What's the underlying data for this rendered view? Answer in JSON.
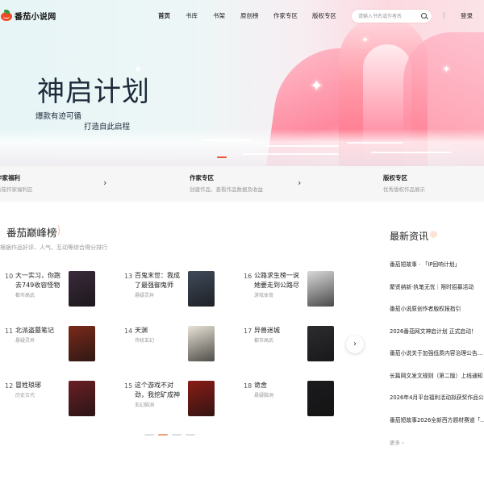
{
  "header": {
    "logo_text": "番茄小说网",
    "nav": [
      "首页",
      "书库",
      "书架",
      "原创榜",
      "作家专区",
      "版权专区"
    ],
    "search_placeholder": "请输入书名或作者名",
    "login": "登录"
  },
  "banner": {
    "title": "神启计划",
    "subtitle_line1": "爆款有迹可循",
    "subtitle_line2": "打造自此启程"
  },
  "features": [
    {
      "title": "作家福利",
      "desc": "番茄作家福利区"
    },
    {
      "title": "作家专区",
      "desc": "创建作品、查看作品数据及收益"
    },
    {
      "title": "版权专区",
      "desc": "优秀版权作品展示"
    }
  ],
  "ranking": {
    "title": "番茄巅峰榜",
    "desc": "根据作品好评、人气、互动等综合得分排行",
    "books": [
      {
        "num": "10",
        "title": "大一实习，你跑去749收容怪物",
        "genre": "都市高武",
        "cover": "#3a2a3a"
      },
      {
        "num": "11",
        "title": "北派盗墓笔记",
        "genre": "悬疑灵异",
        "cover": "#7a2a1a"
      },
      {
        "num": "12",
        "title": "冒姓琅琊",
        "genre": "历史古代",
        "cover": "#6a1f24"
      },
      {
        "num": "13",
        "title": "百鬼末世：我成了最强御鬼师",
        "genre": "悬疑灵异",
        "cover": "#3f4a5a"
      },
      {
        "num": "14",
        "title": "天渊",
        "genre": "传统玄幻",
        "cover": "#e9e3d6"
      },
      {
        "num": "15",
        "title": "这个游戏不对劲，我挖矿成神",
        "genre": "玄幻脑洞",
        "cover": "#8a1c16"
      },
      {
        "num": "16",
        "title": "公路求生榜一说她要走到公路尽头",
        "genre": "游戏体育",
        "cover": "#d9d9d9"
      },
      {
        "num": "17",
        "title": "异兽迷城",
        "genre": "都市高武",
        "cover": "#2c2c30"
      },
      {
        "num": "18",
        "title": "诡舍",
        "genre": "悬疑脑洞",
        "cover": "#1b1b1e"
      }
    ]
  },
  "news": {
    "title": "最新资讯",
    "items": [
      "番茄短故事 · 「IP回响计划」",
      "聚贤纳新·执笔无忧｜限时招募活动",
      "番茄小说原创作者版权报指引",
      "2026番茄网文神启计划 正式启动！",
      "番茄小说关于加强低质内容治理公告…",
      "长篇网文发文规则（第二版）上线通知",
      "2026年4月平台福利活动拟获奖作品公…",
      "番茄短故事2026全新西方题材赛道「…"
    ],
    "more": "更多 ›"
  },
  "icons": {
    "search": "search-icon",
    "next": "chevron-right-icon",
    "strip_arrow": "chevron-right-icon"
  },
  "colors": {
    "accent": "#e8542c",
    "banner_pink": "#ff7d92"
  }
}
